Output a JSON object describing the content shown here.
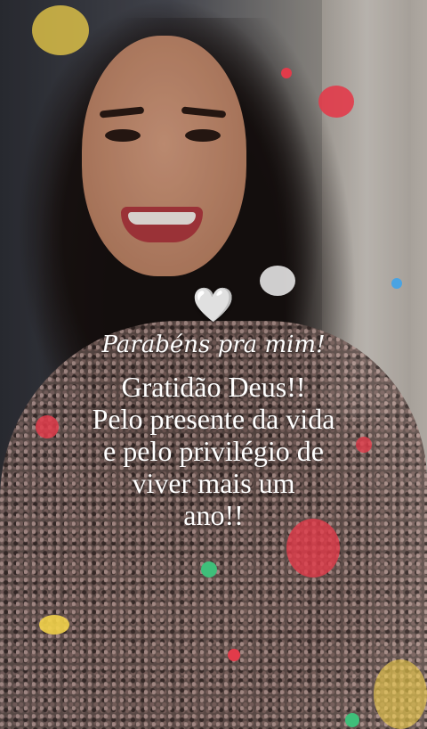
{
  "overlay": {
    "heart": "🤍",
    "heading": "Parabéns pra mim!",
    "lines": [
      "Gratidão Deus!!",
      "Pelo presente da vida",
      "e pelo privilégio de",
      "viver mais um",
      "ano!!"
    ]
  },
  "confetti_colors": [
    "#e23b4a",
    "#f2d14a",
    "#4aa3e2",
    "#ffffff",
    "#3fbf7a"
  ]
}
